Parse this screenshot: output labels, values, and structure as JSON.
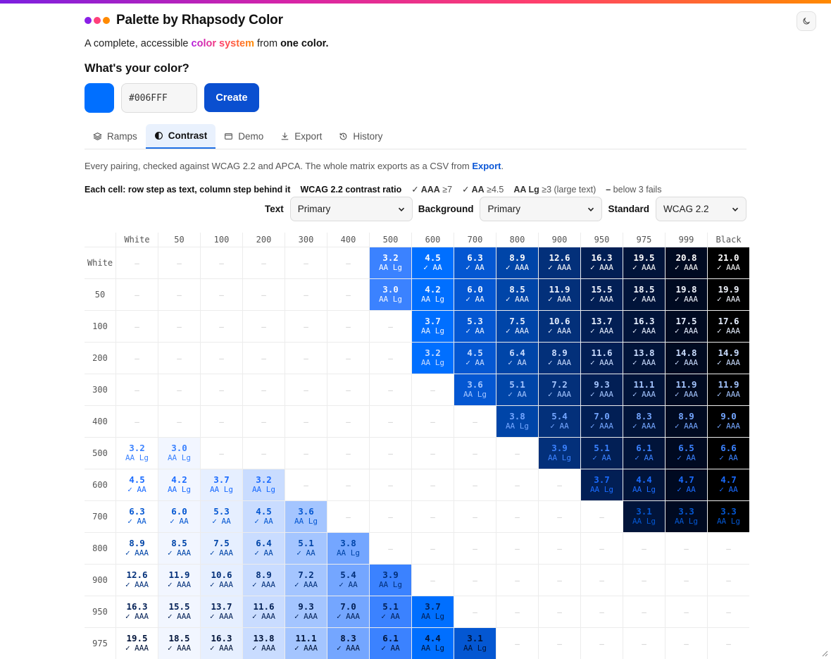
{
  "app": {
    "title": "Palette by Rhapsody Color",
    "tagline": {
      "pre": "A complete, accessible ",
      "accent": "color system",
      "mid": " from ",
      "bold": "one color."
    },
    "brand_dot_colors": [
      "#8a1fe6",
      "#ff3f7a",
      "#ff8a00"
    ],
    "theme_toggle_icon": "moon-icon"
  },
  "picker": {
    "question": "What's your color?",
    "color": "#006FFF",
    "hex_value": "#006FFF",
    "create_label": "Create"
  },
  "tabs": [
    {
      "label": "Ramps",
      "icon": "layers-icon",
      "active": false
    },
    {
      "label": "Contrast",
      "icon": "contrast-icon",
      "active": true
    },
    {
      "label": "Demo",
      "icon": "window-icon",
      "active": false
    },
    {
      "label": "Export",
      "icon": "download-icon",
      "active": false
    },
    {
      "label": "History",
      "icon": "history-icon",
      "active": false
    }
  ],
  "description": {
    "text": "Every pairing, checked against WCAG 2.2 and APCA. The whole matrix exports as a CSV from ",
    "link": "Export",
    "end": "."
  },
  "legend": {
    "cell_help": "Each cell: row step as text, column step behind it",
    "metric": "WCAG 2.2 contrast ratio",
    "aaa": "✓ AAA",
    "aaa_rule": "≥7",
    "aa": "✓ AA",
    "aa_rule": "≥4.5",
    "aalg": "AA Lg",
    "aalg_rule": "≥3 (large text)",
    "fail": "–",
    "fail_rule": "below 3 fails"
  },
  "controls": {
    "text_label": "Text",
    "text_value": "Primary",
    "background_label": "Background",
    "background_value": "Primary",
    "standard_label": "Standard",
    "standard_value": "WCAG 2.2"
  },
  "matrix": {
    "steps": [
      "White",
      "50",
      "100",
      "200",
      "300",
      "400",
      "500",
      "600",
      "700",
      "800",
      "900",
      "950",
      "975",
      "999",
      "Black"
    ],
    "step_colors": [
      "#ffffff",
      "#f2f6ff",
      "#e6efff",
      "#c9dcff",
      "#a4c5ff",
      "#74a6ff",
      "#3b82ff",
      "#006fff",
      "#0457d2",
      "#0045a8",
      "#03307a",
      "#021f55",
      "#01143a",
      "#000a21",
      "#000000"
    ],
    "step_text_colors": [
      "#ffffff",
      "#f2f6ff",
      "#e6efff",
      "#c9dcff",
      "#a4c5ff",
      "#74a6ff",
      "#3b82ff",
      "#1a6bff",
      "#0457d2",
      "#0045a8",
      "#03307a",
      "#021f55",
      "#01143a",
      "#000a21",
      "#000000"
    ],
    "fail_mark": "–",
    "rows": [
      [
        "",
        "",
        "",
        "",
        "",
        "",
        "3.2",
        "4.5",
        "6.3",
        "8.9",
        "12.6",
        "16.3",
        "19.5",
        "20.8",
        "21.0"
      ],
      [
        "",
        "",
        "",
        "",
        "",
        "",
        "3.0",
        "4.2",
        "6.0",
        "8.5",
        "11.9",
        "15.5",
        "18.5",
        "19.8",
        "19.9"
      ],
      [
        "",
        "",
        "",
        "",
        "",
        "",
        "",
        "3.7",
        "5.3",
        "7.5",
        "10.6",
        "13.7",
        "16.3",
        "17.5",
        "17.6"
      ],
      [
        "",
        "",
        "",
        "",
        "",
        "",
        "",
        "3.2",
        "4.5",
        "6.4",
        "8.9",
        "11.6",
        "13.8",
        "14.8",
        "14.9"
      ],
      [
        "",
        "",
        "",
        "",
        "",
        "",
        "",
        "",
        "3.6",
        "5.1",
        "7.2",
        "9.3",
        "11.1",
        "11.9",
        "11.9"
      ],
      [
        "",
        "",
        "",
        "",
        "",
        "",
        "",
        "",
        "",
        "3.8",
        "5.4",
        "7.0",
        "8.3",
        "8.9",
        "9.0"
      ],
      [
        "3.2",
        "3.0",
        "",
        "",
        "",
        "",
        "",
        "",
        "",
        "",
        "3.9",
        "5.1",
        "6.1",
        "6.5",
        "6.6"
      ],
      [
        "4.5",
        "4.2",
        "3.7",
        "3.2",
        "",
        "",
        "",
        "",
        "",
        "",
        "",
        "3.7",
        "4.4",
        "4.7",
        "4.7"
      ],
      [
        "6.3",
        "6.0",
        "5.3",
        "4.5",
        "3.6",
        "",
        "",
        "",
        "",
        "",
        "",
        "",
        "3.1",
        "3.3",
        "3.3"
      ],
      [
        "8.9",
        "8.5",
        "7.5",
        "6.4",
        "5.1",
        "3.8",
        "",
        "",
        "",
        "",
        "",
        "",
        "",
        "",
        ""
      ],
      [
        "12.6",
        "11.9",
        "10.6",
        "8.9",
        "7.2",
        "5.4",
        "3.9",
        "",
        "",
        "",
        "",
        "",
        "",
        "",
        ""
      ],
      [
        "16.3",
        "15.5",
        "13.7",
        "11.6",
        "9.3",
        "7.0",
        "5.1",
        "3.7",
        "",
        "",
        "",
        "",
        "",
        "",
        ""
      ],
      [
        "19.5",
        "18.5",
        "16.3",
        "13.8",
        "11.1",
        "8.3",
        "6.1",
        "4.4",
        "3.1",
        "",
        "",
        "",
        "",
        "",
        ""
      ]
    ]
  }
}
